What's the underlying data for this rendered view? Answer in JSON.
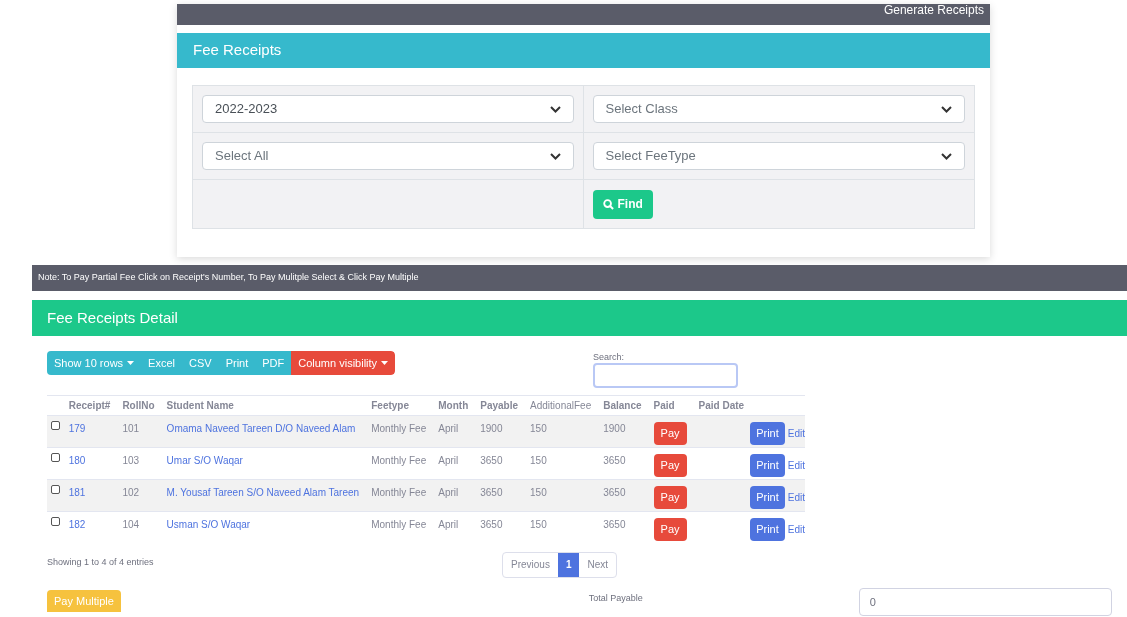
{
  "top_bar": {
    "link": "Generate Receipts"
  },
  "filter_panel": {
    "title": "Fee Receipts",
    "selects": [
      {
        "value": "2022-2023",
        "placeholder": false
      },
      {
        "value": "Select Class",
        "placeholder": true
      },
      {
        "value": "Select All",
        "placeholder": true
      },
      {
        "value": "Select FeeType",
        "placeholder": true
      }
    ],
    "find_button": "Find"
  },
  "note": "Note: To Pay Partial Fee Click on Receipt's Number, To Pay Mulitple Select & Click Pay Multiple",
  "detail": {
    "title": "Fee Receipts Detail",
    "toolbar": [
      {
        "label": "Show 10 rows",
        "kind": "dropdown"
      },
      {
        "label": "Excel",
        "kind": "plain"
      },
      {
        "label": "CSV",
        "kind": "plain"
      },
      {
        "label": "Print",
        "kind": "plain"
      },
      {
        "label": "PDF",
        "kind": "plain"
      },
      {
        "label": "Column visibility",
        "kind": "danger"
      }
    ],
    "search": {
      "label": "Search:"
    },
    "table": {
      "columns": [
        "Receipt#",
        "RollNo",
        "Student Name",
        "Feetype",
        "Month",
        "Payable",
        "AdditionalFee",
        "Balance",
        "Paid",
        "Paid Date"
      ],
      "rows": [
        {
          "checked": false,
          "receipt": "179",
          "roll": "101",
          "name": "Omama Naveed Tareen D/O Naveed Alam",
          "feetype": "Monthly Fee",
          "month": "April",
          "payable": "1900",
          "additional": "150",
          "balance": "1900",
          "pay": "Pay",
          "print": "Print",
          "edit": "Edit"
        },
        {
          "checked": false,
          "receipt": "180",
          "roll": "103",
          "name": "Umar S/O Waqar",
          "feetype": "Monthly Fee",
          "month": "April",
          "payable": "3650",
          "additional": "150",
          "balance": "3650",
          "pay": "Pay",
          "print": "Print",
          "edit": "Edit"
        },
        {
          "checked": false,
          "receipt": "181",
          "roll": "102",
          "name": "M. Yousaf Tareen S/O Naveed Alam Tareen",
          "feetype": "Monthly Fee",
          "month": "April",
          "payable": "3650",
          "additional": "150",
          "balance": "3650",
          "pay": "Pay",
          "print": "Print",
          "edit": "Edit"
        },
        {
          "checked": false,
          "receipt": "182",
          "roll": "104",
          "name": "Usman S/O Waqar",
          "feetype": "Monthly Fee",
          "month": "April",
          "payable": "3650",
          "additional": "150",
          "balance": "3650",
          "pay": "Pay",
          "print": "Print",
          "edit": "Edit"
        }
      ]
    },
    "info": "Showing 1 to 4 of 4 entries",
    "pagination": [
      {
        "label": "Previous",
        "selected": false
      },
      {
        "label": "1",
        "selected": true
      },
      {
        "label": "Next",
        "selected": false
      }
    ],
    "pay_multiple": "Pay Multiple",
    "total": {
      "label": "Total Payable",
      "value": "0"
    }
  }
}
